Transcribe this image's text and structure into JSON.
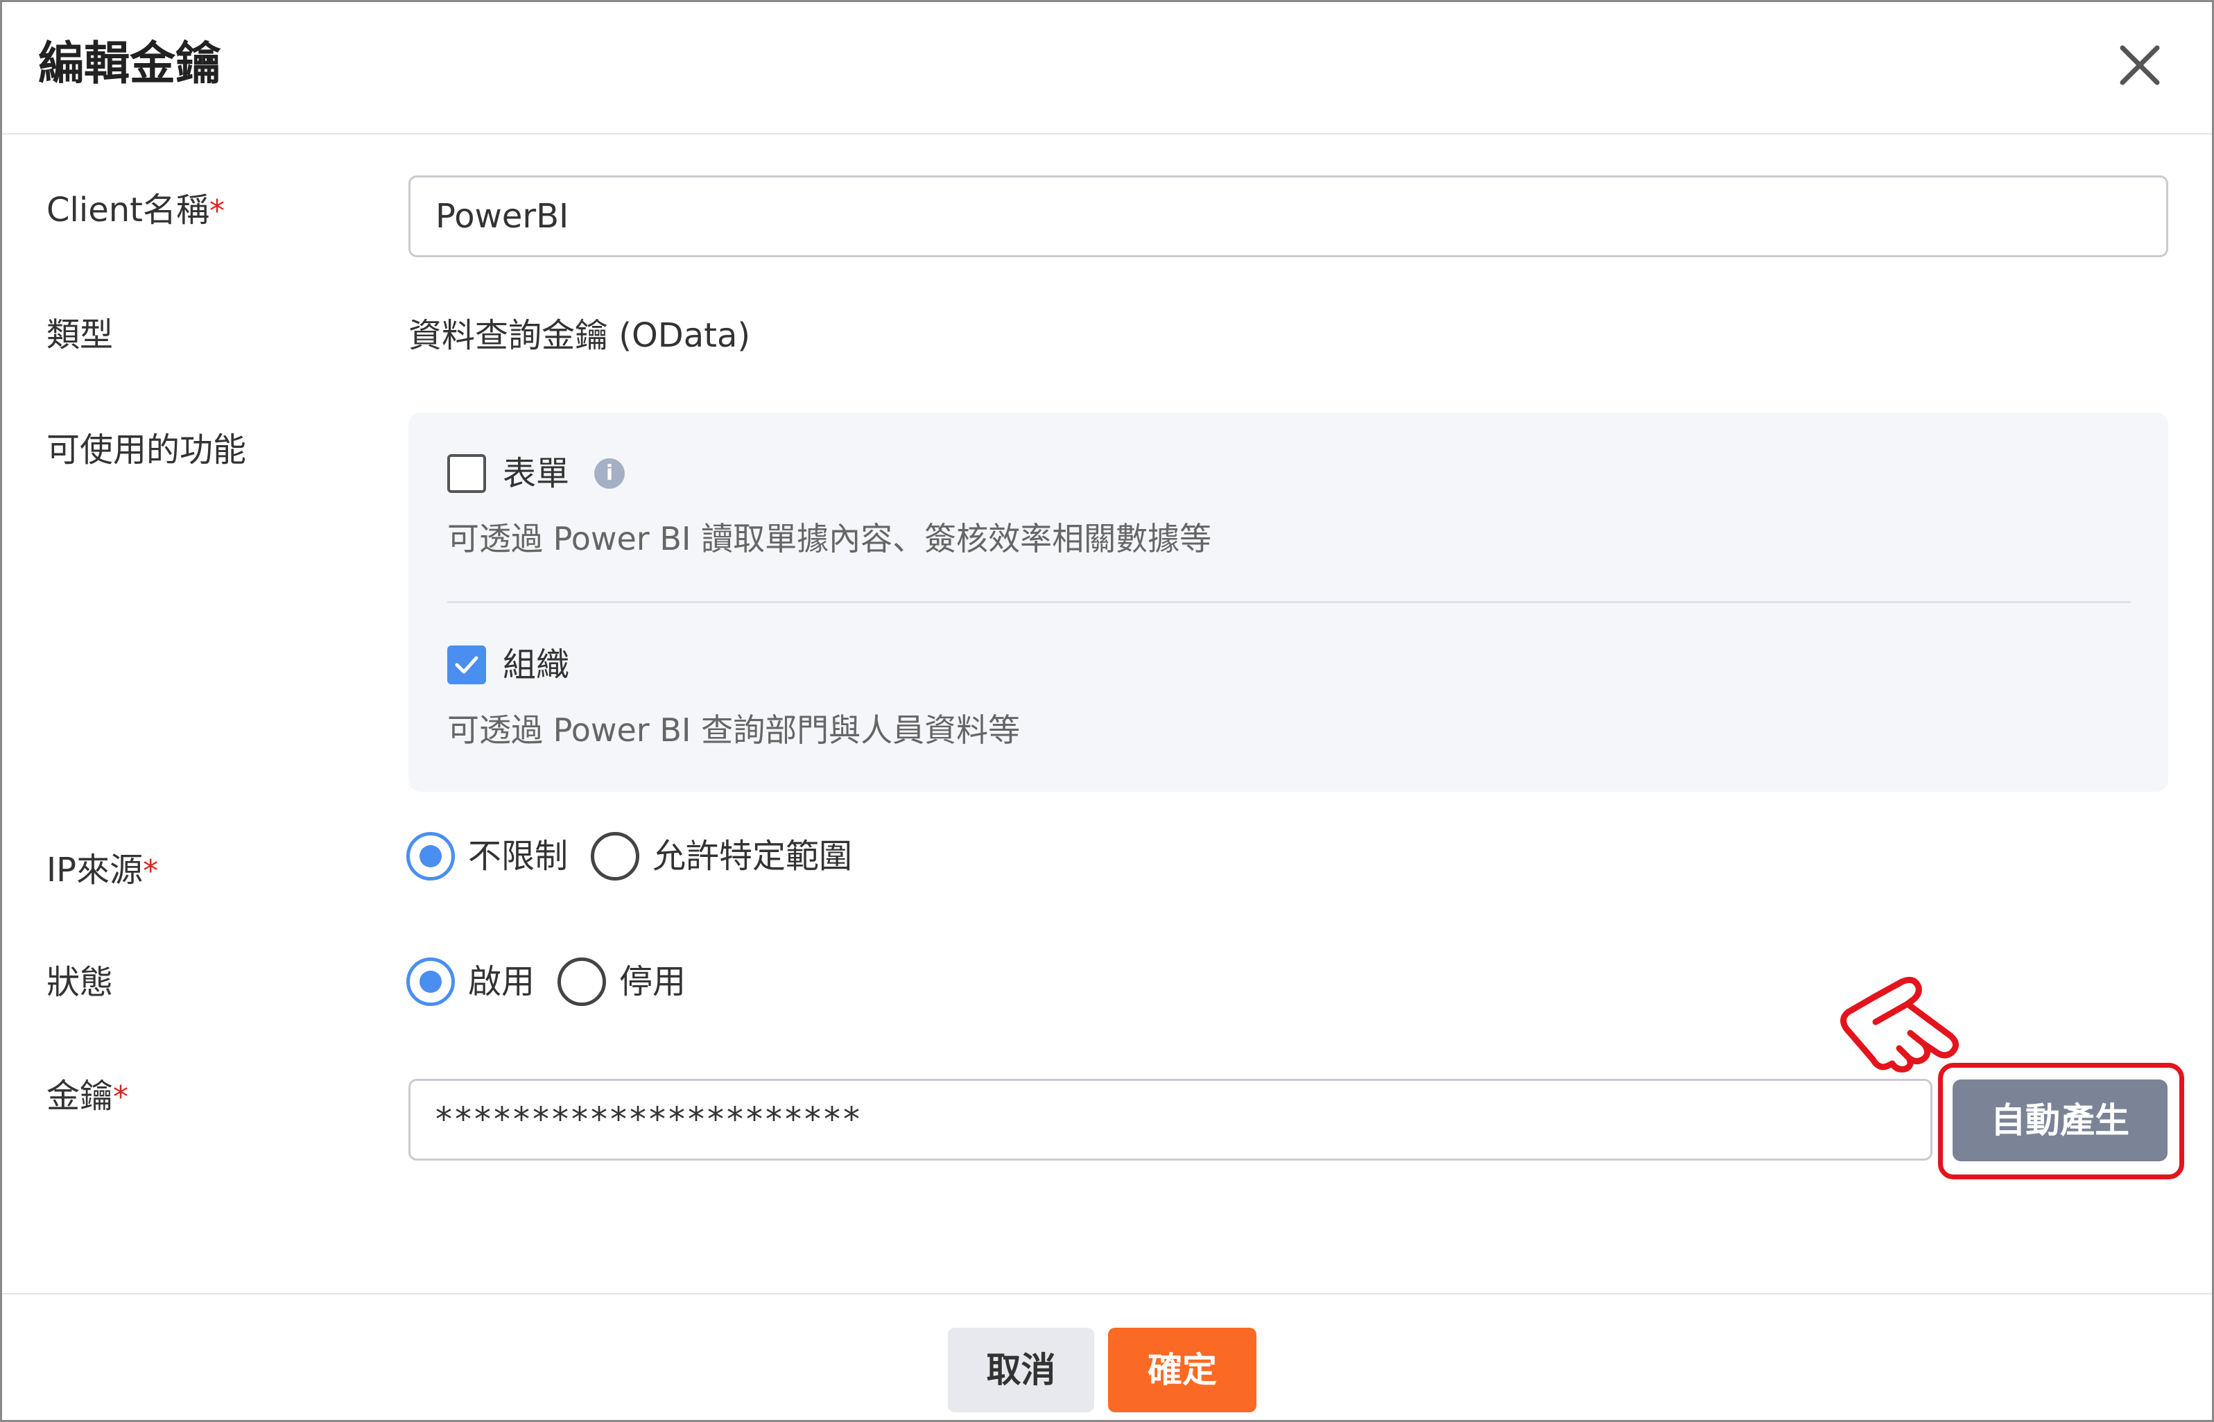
{
  "dialog": {
    "title": "編輯金鑰",
    "close_icon": "close-icon"
  },
  "form": {
    "client_name": {
      "label": "Client名稱",
      "required_mark": "*",
      "value": "PowerBI"
    },
    "type": {
      "label": "類型",
      "value": "資料查詢金鑰 (OData)"
    },
    "features": {
      "label": "可使用的功能",
      "items": [
        {
          "label": "表單",
          "checked": false,
          "info_icon": "i",
          "description": "可透過 Power BI 讀取單據內容、簽核效率相關數據等"
        },
        {
          "label": "組織",
          "checked": true,
          "description": "可透過 Power BI 查詢部門與人員資料等"
        }
      ]
    },
    "ip_source": {
      "label": "IP來源",
      "required_mark": "*",
      "options": [
        {
          "label": "不限制",
          "selected": true
        },
        {
          "label": "允許特定範圍",
          "selected": false
        }
      ]
    },
    "status": {
      "label": "狀態",
      "options": [
        {
          "label": "啟用",
          "selected": true
        },
        {
          "label": "停用",
          "selected": false
        }
      ]
    },
    "key": {
      "label": "金鑰",
      "required_mark": "*",
      "value": "**********************",
      "generate_button": "自動產生"
    }
  },
  "footer": {
    "cancel_label": "取消",
    "confirm_label": "確定"
  },
  "colors": {
    "accent_blue": "#4a8ef0",
    "confirm_orange": "#fb6a25",
    "generate_button_gray": "#7b8396",
    "highlight_red": "#e3141c",
    "required_red": "#e02020"
  }
}
